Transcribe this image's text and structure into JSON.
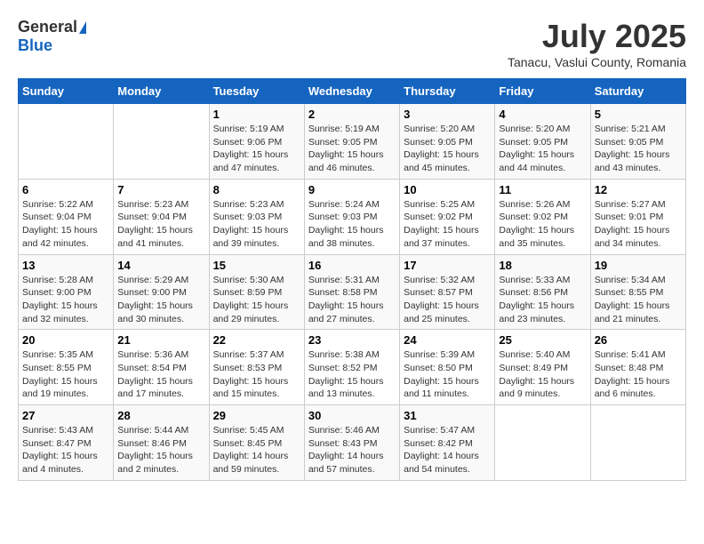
{
  "logo": {
    "general": "General",
    "blue": "Blue"
  },
  "title": "July 2025",
  "location": "Tanacu, Vaslui County, Romania",
  "days_of_week": [
    "Sunday",
    "Monday",
    "Tuesday",
    "Wednesday",
    "Thursday",
    "Friday",
    "Saturday"
  ],
  "weeks": [
    [
      {
        "day": "",
        "sunrise": "",
        "sunset": "",
        "daylight": ""
      },
      {
        "day": "",
        "sunrise": "",
        "sunset": "",
        "daylight": ""
      },
      {
        "day": "1",
        "sunrise": "Sunrise: 5:19 AM",
        "sunset": "Sunset: 9:06 PM",
        "daylight": "Daylight: 15 hours and 47 minutes."
      },
      {
        "day": "2",
        "sunrise": "Sunrise: 5:19 AM",
        "sunset": "Sunset: 9:05 PM",
        "daylight": "Daylight: 15 hours and 46 minutes."
      },
      {
        "day": "3",
        "sunrise": "Sunrise: 5:20 AM",
        "sunset": "Sunset: 9:05 PM",
        "daylight": "Daylight: 15 hours and 45 minutes."
      },
      {
        "day": "4",
        "sunrise": "Sunrise: 5:20 AM",
        "sunset": "Sunset: 9:05 PM",
        "daylight": "Daylight: 15 hours and 44 minutes."
      },
      {
        "day": "5",
        "sunrise": "Sunrise: 5:21 AM",
        "sunset": "Sunset: 9:05 PM",
        "daylight": "Daylight: 15 hours and 43 minutes."
      }
    ],
    [
      {
        "day": "6",
        "sunrise": "Sunrise: 5:22 AM",
        "sunset": "Sunset: 9:04 PM",
        "daylight": "Daylight: 15 hours and 42 minutes."
      },
      {
        "day": "7",
        "sunrise": "Sunrise: 5:23 AM",
        "sunset": "Sunset: 9:04 PM",
        "daylight": "Daylight: 15 hours and 41 minutes."
      },
      {
        "day": "8",
        "sunrise": "Sunrise: 5:23 AM",
        "sunset": "Sunset: 9:03 PM",
        "daylight": "Daylight: 15 hours and 39 minutes."
      },
      {
        "day": "9",
        "sunrise": "Sunrise: 5:24 AM",
        "sunset": "Sunset: 9:03 PM",
        "daylight": "Daylight: 15 hours and 38 minutes."
      },
      {
        "day": "10",
        "sunrise": "Sunrise: 5:25 AM",
        "sunset": "Sunset: 9:02 PM",
        "daylight": "Daylight: 15 hours and 37 minutes."
      },
      {
        "day": "11",
        "sunrise": "Sunrise: 5:26 AM",
        "sunset": "Sunset: 9:02 PM",
        "daylight": "Daylight: 15 hours and 35 minutes."
      },
      {
        "day": "12",
        "sunrise": "Sunrise: 5:27 AM",
        "sunset": "Sunset: 9:01 PM",
        "daylight": "Daylight: 15 hours and 34 minutes."
      }
    ],
    [
      {
        "day": "13",
        "sunrise": "Sunrise: 5:28 AM",
        "sunset": "Sunset: 9:00 PM",
        "daylight": "Daylight: 15 hours and 32 minutes."
      },
      {
        "day": "14",
        "sunrise": "Sunrise: 5:29 AM",
        "sunset": "Sunset: 9:00 PM",
        "daylight": "Daylight: 15 hours and 30 minutes."
      },
      {
        "day": "15",
        "sunrise": "Sunrise: 5:30 AM",
        "sunset": "Sunset: 8:59 PM",
        "daylight": "Daylight: 15 hours and 29 minutes."
      },
      {
        "day": "16",
        "sunrise": "Sunrise: 5:31 AM",
        "sunset": "Sunset: 8:58 PM",
        "daylight": "Daylight: 15 hours and 27 minutes."
      },
      {
        "day": "17",
        "sunrise": "Sunrise: 5:32 AM",
        "sunset": "Sunset: 8:57 PM",
        "daylight": "Daylight: 15 hours and 25 minutes."
      },
      {
        "day": "18",
        "sunrise": "Sunrise: 5:33 AM",
        "sunset": "Sunset: 8:56 PM",
        "daylight": "Daylight: 15 hours and 23 minutes."
      },
      {
        "day": "19",
        "sunrise": "Sunrise: 5:34 AM",
        "sunset": "Sunset: 8:55 PM",
        "daylight": "Daylight: 15 hours and 21 minutes."
      }
    ],
    [
      {
        "day": "20",
        "sunrise": "Sunrise: 5:35 AM",
        "sunset": "Sunset: 8:55 PM",
        "daylight": "Daylight: 15 hours and 19 minutes."
      },
      {
        "day": "21",
        "sunrise": "Sunrise: 5:36 AM",
        "sunset": "Sunset: 8:54 PM",
        "daylight": "Daylight: 15 hours and 17 minutes."
      },
      {
        "day": "22",
        "sunrise": "Sunrise: 5:37 AM",
        "sunset": "Sunset: 8:53 PM",
        "daylight": "Daylight: 15 hours and 15 minutes."
      },
      {
        "day": "23",
        "sunrise": "Sunrise: 5:38 AM",
        "sunset": "Sunset: 8:52 PM",
        "daylight": "Daylight: 15 hours and 13 minutes."
      },
      {
        "day": "24",
        "sunrise": "Sunrise: 5:39 AM",
        "sunset": "Sunset: 8:50 PM",
        "daylight": "Daylight: 15 hours and 11 minutes."
      },
      {
        "day": "25",
        "sunrise": "Sunrise: 5:40 AM",
        "sunset": "Sunset: 8:49 PM",
        "daylight": "Daylight: 15 hours and 9 minutes."
      },
      {
        "day": "26",
        "sunrise": "Sunrise: 5:41 AM",
        "sunset": "Sunset: 8:48 PM",
        "daylight": "Daylight: 15 hours and 6 minutes."
      }
    ],
    [
      {
        "day": "27",
        "sunrise": "Sunrise: 5:43 AM",
        "sunset": "Sunset: 8:47 PM",
        "daylight": "Daylight: 15 hours and 4 minutes."
      },
      {
        "day": "28",
        "sunrise": "Sunrise: 5:44 AM",
        "sunset": "Sunset: 8:46 PM",
        "daylight": "Daylight: 15 hours and 2 minutes."
      },
      {
        "day": "29",
        "sunrise": "Sunrise: 5:45 AM",
        "sunset": "Sunset: 8:45 PM",
        "daylight": "Daylight: 14 hours and 59 minutes."
      },
      {
        "day": "30",
        "sunrise": "Sunrise: 5:46 AM",
        "sunset": "Sunset: 8:43 PM",
        "daylight": "Daylight: 14 hours and 57 minutes."
      },
      {
        "day": "31",
        "sunrise": "Sunrise: 5:47 AM",
        "sunset": "Sunset: 8:42 PM",
        "daylight": "Daylight: 14 hours and 54 minutes."
      },
      {
        "day": "",
        "sunrise": "",
        "sunset": "",
        "daylight": ""
      },
      {
        "day": "",
        "sunrise": "",
        "sunset": "",
        "daylight": ""
      }
    ]
  ]
}
